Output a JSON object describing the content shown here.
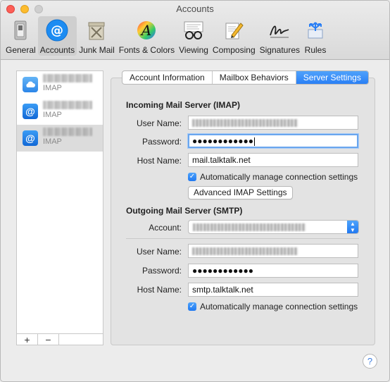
{
  "window": {
    "title": "Accounts"
  },
  "toolbar": {
    "items": [
      {
        "label": "General",
        "icon": "general-switch-icon"
      },
      {
        "label": "Accounts",
        "icon": "at-sign-icon",
        "active": true
      },
      {
        "label": "Junk Mail",
        "icon": "junk-mail-bin-icon"
      },
      {
        "label": "Fonts & Colors",
        "icon": "fonts-colors-icon"
      },
      {
        "label": "Viewing",
        "icon": "viewing-glasses-icon"
      },
      {
        "label": "Composing",
        "icon": "composing-pencil-icon"
      },
      {
        "label": "Signatures",
        "icon": "signature-icon"
      },
      {
        "label": "Rules",
        "icon": "rules-arrows-icon"
      }
    ]
  },
  "sidebar": {
    "accounts": [
      {
        "type": "IMAP",
        "icon": "icloud-icon"
      },
      {
        "type": "IMAP",
        "icon": "at-sign-icon"
      },
      {
        "type": "IMAP",
        "icon": "at-sign-icon",
        "selected": true
      }
    ],
    "add_label": "+",
    "remove_label": "−"
  },
  "tabs": [
    {
      "label": "Account Information"
    },
    {
      "label": "Mailbox Behaviors"
    },
    {
      "label": "Server Settings",
      "active": true
    }
  ],
  "incoming": {
    "heading": "Incoming Mail Server (IMAP)",
    "user_label": "User Name:",
    "password_label": "Password:",
    "password_value": "●●●●●●●●●●●●",
    "host_label": "Host Name:",
    "host_value": "mail.talktalk.net",
    "auto_manage_label": "Automatically manage connection settings",
    "advanced_button": "Advanced IMAP Settings"
  },
  "outgoing": {
    "heading": "Outgoing Mail Server (SMTP)",
    "account_label": "Account:",
    "user_label": "User Name:",
    "password_label": "Password:",
    "password_value": "●●●●●●●●●●●●",
    "host_label": "Host Name:",
    "host_value": "smtp.talktalk.net",
    "auto_manage_label": "Automatically manage connection settings"
  },
  "help_label": "?",
  "colors": {
    "accent": "#2a7ff5",
    "traffic_close": "#fd5f57",
    "traffic_min": "#fdbc2e"
  }
}
